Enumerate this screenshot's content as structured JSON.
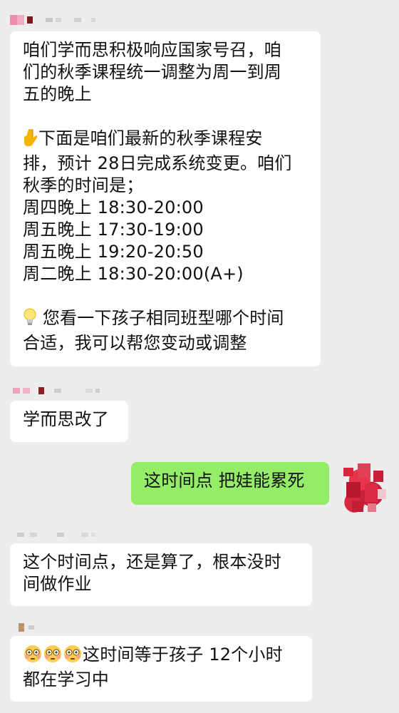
{
  "messages": [
    {
      "id": "m1",
      "side": "left",
      "lines": [
        "咱们学而思积极响应国家号召，咱",
        "们的秋季课程统一调整为周一到周",
        "五的晚上",
        "",
        "{pointer}下面是咱们最新的秋季课程安",
        "排，预计 28日完成系统变更。咱们",
        "秋季的时间是；",
        "周四晚上 18:30-20:00",
        "周五晚上 17:30-19:00",
        "周五晚上 19:20-20:50",
        "周二晚上 18:30-20:00(A+)",
        "",
        "{bulb} 您看一下孩子相同班型哪个时间",
        "合适，我可以帮您变动或调整"
      ]
    },
    {
      "id": "m2",
      "side": "left",
      "lines": [
        "学而思改了"
      ]
    },
    {
      "id": "m3",
      "side": "right",
      "lines": [
        "这时间点 把娃能累死"
      ]
    },
    {
      "id": "m4",
      "side": "left",
      "lines": [
        "这个时间点，还是算了，根本没时",
        "间做作业"
      ]
    },
    {
      "id": "m5",
      "side": "left",
      "lines": [
        "{flushed}{flushed}{flushed}这时间等于孩子 12个小时",
        "都在学习中"
      ]
    }
  ],
  "icons": {
    "pointer": "backhand-index-pointing-down-icon",
    "bulb": "light-bulb-icon",
    "flushed": "flushed-face-icon"
  },
  "colors": {
    "background": "#ededed",
    "incoming_bubble": "#ffffff",
    "outgoing_bubble": "#95ec69"
  }
}
